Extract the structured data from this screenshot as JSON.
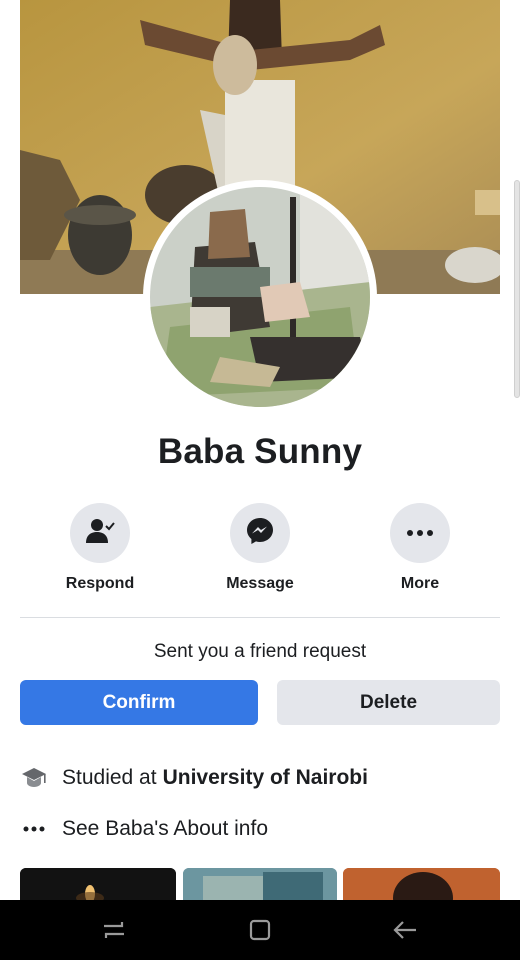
{
  "profile": {
    "name": "Baba Sunny"
  },
  "actions": [
    {
      "label": "Respond",
      "icon": "respond-person-check-icon"
    },
    {
      "label": "Message",
      "icon": "messenger-icon"
    },
    {
      "label": "More",
      "icon": "more-dots-icon"
    }
  ],
  "friend_request": {
    "text": "Sent you a friend request",
    "confirm_label": "Confirm",
    "delete_label": "Delete"
  },
  "intro": {
    "studied_prefix": "Studied at",
    "studied_school": "University of Nairobi",
    "about_text": "See Baba's About info"
  },
  "icons": {
    "education": "graduation-cap-icon",
    "about": "ellipsis-icon",
    "nav_recent": "recent-apps-icon",
    "nav_home": "home-square-icon",
    "nav_back": "back-arrow-icon"
  },
  "colors": {
    "accent": "#3578e5",
    "button_gray": "#e4e6eb",
    "text": "#1c1e21",
    "navbar": "#000000"
  }
}
